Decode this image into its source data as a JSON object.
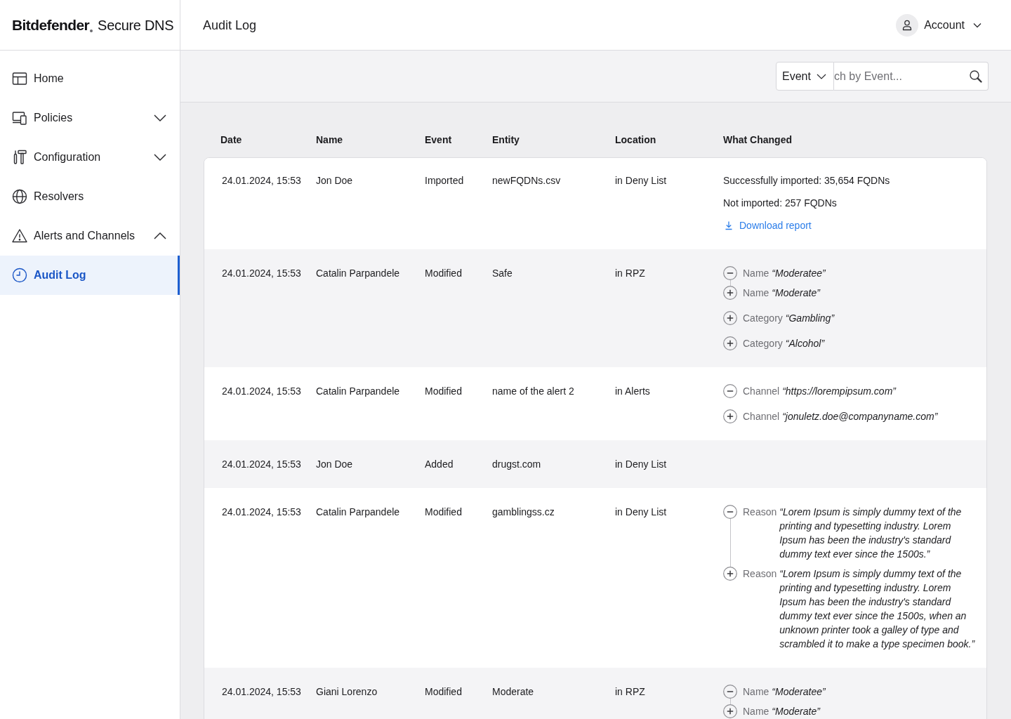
{
  "sidebar": {
    "brand": "Bitdefender",
    "product": "Secure DNS",
    "items": [
      {
        "label": "Home",
        "selected": false
      },
      {
        "label": "Policies",
        "selected": false,
        "expanded": false
      },
      {
        "label": "Configuration",
        "selected": false,
        "expanded": false
      },
      {
        "label": "Resolvers",
        "selected": false
      },
      {
        "label": "Alerts and Channels",
        "selected": false,
        "expanded": true,
        "children": [
          {
            "label": "Audit Log",
            "selected": true
          }
        ]
      }
    ]
  },
  "header": {
    "title": "Audit Log",
    "account": "Account"
  },
  "filter": {
    "field": "Event",
    "search_placeholder": "ch by Event..."
  },
  "table": {
    "columns": [
      "Date",
      "Name",
      "Event",
      "Entity",
      "Location",
      "What Changed"
    ],
    "rows": [
      {
        "date": "24.01.2024, 15:53",
        "name": "Jon Doe",
        "event": "Imported",
        "entity": "newFQDNs.csv",
        "location": "in Deny List",
        "what_changed": [
          {
            "kind": "text",
            "text": "Successfully imported: 35,654 FQDNs"
          },
          {
            "kind": "text",
            "text": "Not imported: 257 FQDNs"
          },
          {
            "kind": "link",
            "text": "Download report"
          }
        ]
      },
      {
        "date": "24.01.2024, 15:53",
        "name": "Catalin Parpandele",
        "event": "Modified",
        "entity": "Safe",
        "location": "in RPZ",
        "what_changed": [
          {
            "kind": "group",
            "changes": [
              {
                "kind": "removed",
                "label": "Name",
                "value": "“Moderatee”"
              },
              {
                "kind": "added",
                "label": "Name",
                "value": "“Moderate”"
              }
            ]
          },
          {
            "kind": "group",
            "changes": [
              {
                "kind": "added",
                "label": "Category",
                "value": "“Gambling”"
              }
            ]
          },
          {
            "kind": "group",
            "changes": [
              {
                "kind": "added",
                "label": "Category",
                "value": "“Alcohol”"
              }
            ]
          }
        ]
      },
      {
        "date": "24.01.2024, 15:53",
        "name": "Catalin Parpandele",
        "event": "Modified",
        "entity": "name of the alert 2",
        "location": "in Alerts",
        "what_changed": [
          {
            "kind": "group",
            "changes": [
              {
                "kind": "removed",
                "label": "Channel",
                "value": "“https://lorempipsum.com”"
              }
            ]
          },
          {
            "kind": "group",
            "changes": [
              {
                "kind": "added",
                "label": "Channel",
                "value": "“jonuletz.doe@companyname.com”"
              }
            ]
          }
        ]
      },
      {
        "date": "24.01.2024, 15:53",
        "name": "Jon Doe",
        "event": "Added",
        "entity": "drugst.com",
        "location": "in Deny List"
      },
      {
        "date": "24.01.2024, 15:53",
        "name": "Catalin Parpandele",
        "event": "Modified",
        "entity": "gamblingss.cz",
        "location": "in Deny List",
        "what_changed": [
          {
            "kind": "group",
            "changes": [
              {
                "kind": "removed",
                "label": "Reason",
                "value": "“Lorem Ipsum is simply dummy text of the printing and typesetting industry. Lorem Ipsum has been the industry's standard dummy text ever since the 1500s.”"
              },
              {
                "kind": "added",
                "label": "Reason",
                "value": "“Lorem Ipsum is simply dummy text of the printing and typesetting industry. Lorem Ipsum has been the industry's standard dummy text ever since the 1500s, when an unknown printer took a galley of type and scrambled it to make a type specimen book.”"
              }
            ]
          }
        ]
      },
      {
        "date": "24.01.2024, 15:53",
        "name": "Giani Lorenzo",
        "event": "Modified",
        "entity": "Moderate",
        "location": "in RPZ",
        "what_changed": [
          {
            "kind": "group",
            "changes": [
              {
                "kind": "removed",
                "label": "Name",
                "value": "“Moderatee”"
              },
              {
                "kind": "added",
                "label": "Name",
                "value": "“Moderate”"
              }
            ]
          }
        ]
      }
    ]
  }
}
